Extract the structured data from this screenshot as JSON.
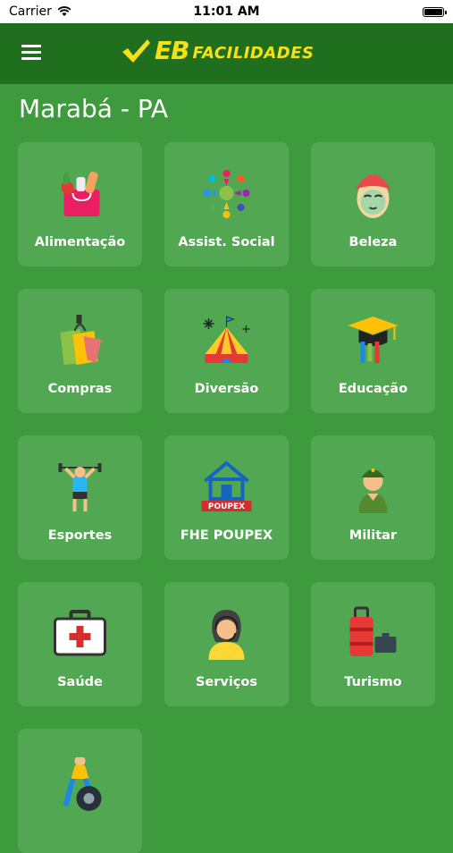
{
  "status": {
    "carrier": "Carrier",
    "time": "11:01 AM"
  },
  "header": {
    "logo_mark": "EB",
    "logo_text": "FACILIDADES",
    "menu_icon": "hamburger-menu-icon"
  },
  "city": "Marabá - PA",
  "colors": {
    "background": "#3d9b3d",
    "header": "#1f6f1f",
    "tile": "#52a852",
    "logo": "#f5e11a"
  },
  "categories": [
    {
      "label": "Alimentação",
      "icon": "grocery-bag-icon"
    },
    {
      "label": "Assist. Social",
      "icon": "social-people-icon"
    },
    {
      "label": "Beleza",
      "icon": "face-mask-icon"
    },
    {
      "label": "Compras",
      "icon": "shopping-bags-icon"
    },
    {
      "label": "Diversão",
      "icon": "circus-tent-icon"
    },
    {
      "label": "Educação",
      "icon": "graduation-cap-icon"
    },
    {
      "label": "Esportes",
      "icon": "weightlifter-icon"
    },
    {
      "label": "FHE POUPEX",
      "icon": "poupex-house-icon",
      "badge": "POUPEX"
    },
    {
      "label": "Militar",
      "icon": "soldier-icon"
    },
    {
      "label": "Saúde",
      "icon": "first-aid-kit-icon"
    },
    {
      "label": "Serviços",
      "icon": "support-agent-icon"
    },
    {
      "label": "Turismo",
      "icon": "luggage-icon"
    },
    {
      "label": "",
      "icon": "mechanic-tire-icon"
    }
  ]
}
